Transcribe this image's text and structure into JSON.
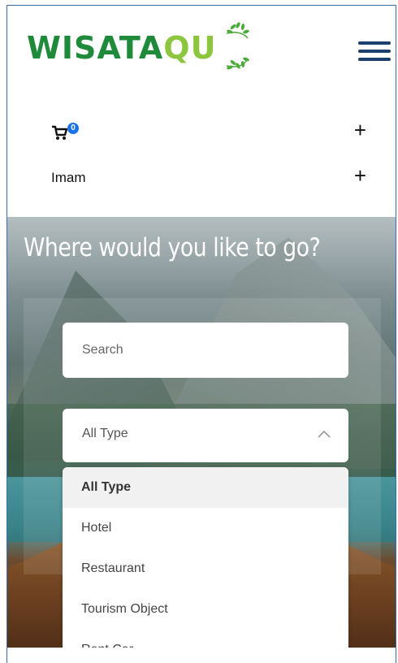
{
  "brand": {
    "logo_main": "WISATA",
    "logo_accent": "QU"
  },
  "nav": {
    "cart_count": "0",
    "user_label": "Imam",
    "expand_symbol": "+"
  },
  "hero": {
    "title": "Where would you like to go?",
    "search_placeholder": "Search",
    "type_select": {
      "selected": "All Type",
      "options": [
        "All Type",
        "Hotel",
        "Restaurant",
        "Tourism Object",
        "Rent Car"
      ]
    }
  },
  "colors": {
    "brand_green": "#1e8a3a",
    "brand_lightgreen": "#8cc63f",
    "menu_navy": "#1d3f6e",
    "badge_blue": "#1a73e8"
  }
}
